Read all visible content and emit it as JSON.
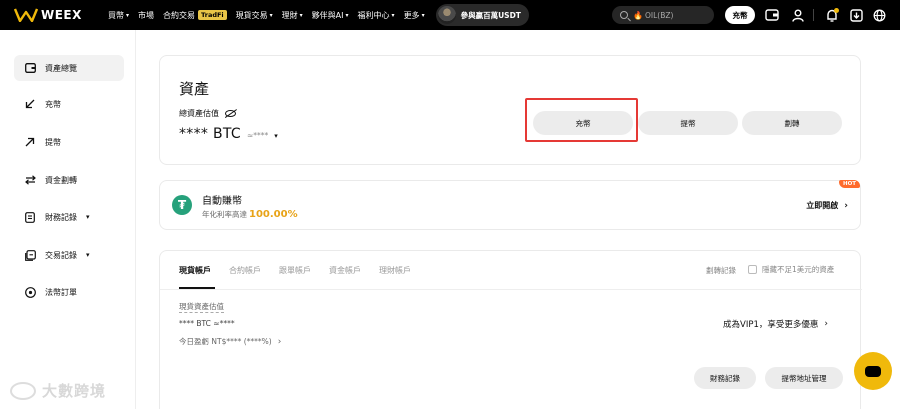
{
  "topbar": {
    "brand": "WEEX",
    "nav": [
      {
        "label": "買幣",
        "caret": true
      },
      {
        "label": "市場",
        "caret": false
      },
      {
        "label": "合約交易",
        "badge": "TradFi",
        "caret": false
      },
      {
        "label": "現貨交易",
        "caret": true
      },
      {
        "label": "理財",
        "caret": true
      },
      {
        "label": "夥伴與AI",
        "caret": true
      },
      {
        "label": "福利中心",
        "caret": true
      },
      {
        "label": "更多",
        "caret": true
      }
    ],
    "promo": "參與贏百萬USDT",
    "search_text": "OIL(BZ)",
    "deposit_label": "充幣"
  },
  "sidebar": {
    "items": [
      {
        "label": "資產總覽",
        "icon": "wallet-icon"
      },
      {
        "label": "充幣",
        "icon": "arrow-down-left-icon"
      },
      {
        "label": "提幣",
        "icon": "arrow-up-right-icon"
      },
      {
        "label": "資金劃轉",
        "icon": "transfer-icon"
      },
      {
        "label": "財務記錄",
        "icon": "document-icon"
      },
      {
        "label": "交易記錄",
        "icon": "trade-record-icon"
      },
      {
        "label": "法幣訂單",
        "icon": "fiat-order-icon"
      }
    ]
  },
  "assets": {
    "title": "資產",
    "est_label": "總資產估值",
    "btc_value": "**** BTC",
    "approx": "≈****",
    "buttons": [
      "充幣",
      "提幣",
      "劃轉"
    ]
  },
  "earn": {
    "title": "自動賺幣",
    "subtitle": "年化利率高達",
    "rate": "100.00%",
    "hot": "HOT",
    "cta": "立即開啟"
  },
  "accounts": {
    "tabs": [
      "現貨帳戶",
      "合約帳戶",
      "跟單帳戶",
      "資金帳戶",
      "理財帳戶"
    ],
    "transfer_record": "劃轉記錄",
    "hide_small": "隱藏不足1美元的資產",
    "spot_label": "現貨資產估值",
    "spot_btc": "****  BTC  ≈****",
    "pnl": "今日盈虧 NT$**** (****%)",
    "vip": "成為VIP1，享受更多優惠",
    "finance_record": "財務記錄",
    "withdraw_addr": "提幣地址管理"
  },
  "watermark": "大數跨境",
  "colors": {
    "accent": "#f0b90b",
    "highlight": "#e53935",
    "tether": "#26a17b",
    "rate": "#e8a317"
  }
}
